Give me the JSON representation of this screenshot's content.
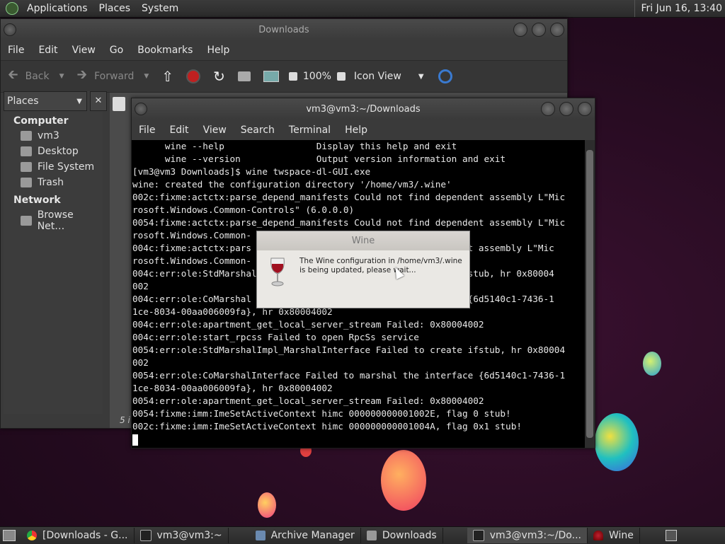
{
  "top_panel": {
    "menus": [
      "Applications",
      "Places",
      "System"
    ],
    "clock": "Fri Jun 16, 13:40"
  },
  "file_manager": {
    "title": "Downloads",
    "menu": [
      "File",
      "Edit",
      "View",
      "Go",
      "Bookmarks",
      "Help"
    ],
    "toolbar": {
      "back": "Back",
      "forward": "Forward",
      "zoom": "100%",
      "view_mode": "Icon View"
    },
    "sidebar": {
      "header": "Places",
      "computer_label": "Computer",
      "computer_items": [
        "vm3",
        "Desktop",
        "File System",
        "Trash"
      ],
      "network_label": "Network",
      "network_items": [
        "Browse Net…"
      ]
    },
    "status_partial": "5 i"
  },
  "terminal": {
    "title": "vm3@vm3:~/Downloads",
    "menu": [
      "File",
      "Edit",
      "View",
      "Search",
      "Terminal",
      "Help"
    ],
    "lines": [
      "      wine --help                 Display this help and exit",
      "      wine --version              Output version information and exit",
      "[vm3@vm3 Downloads]$ wine twspace-dl-GUI.exe",
      "wine: created the configuration directory '/home/vm3/.wine'",
      "002c:fixme:actctx:parse_depend_manifests Could not find dependent assembly L\"Mic",
      "rosoft.Windows.Common-Controls\" (6.0.0.0)",
      "0054:fixme:actctx:parse_depend_manifests Could not find dependent assembly L\"Mic",
      "rosoft.Windows.Common-",
      "004c:fixme:actctx:pars                                   endent assembly L\"Mic",
      "rosoft.Windows.Common-",
      "004c:err:ole:StdMarshal                                  ce ifstub, hr 0x80004",
      "002",
      "004c:err:ole:CoMarshal                                   face {6d5140c1-7436-1",
      "1ce-8034-00aa006009fa}, hr 0x80004002",
      "004c:err:ole:apartment_get_local_server_stream Failed: 0x80004002",
      "004c:err:ole:start_rpcss Failed to open RpcSs service",
      "0054:err:ole:StdMarshalImpl_MarshalInterface Failed to create ifstub, hr 0x80004",
      "002",
      "0054:err:ole:CoMarshalInterface Failed to marshal the interface {6d5140c1-7436-1",
      "1ce-8034-00aa006009fa}, hr 0x80004002",
      "0054:err:ole:apartment_get_local_server_stream Failed: 0x80004002",
      "0054:fixme:imm:ImeSetActiveContext himc 000000000001002E, flag 0 stub!",
      "002c:fixme:imm:ImeSetActiveContext himc 000000000001004A, flag 0x1 stub!"
    ]
  },
  "wine_dialog": {
    "title": "Wine",
    "message": "The Wine configuration in /home/vm3/.wine is being updated, please wait..."
  },
  "taskbar": {
    "items": [
      "[Downloads - G...",
      "vm3@vm3:~",
      "Archive Manager",
      "Downloads",
      "vm3@vm3:~/Do...",
      "Wine"
    ]
  }
}
